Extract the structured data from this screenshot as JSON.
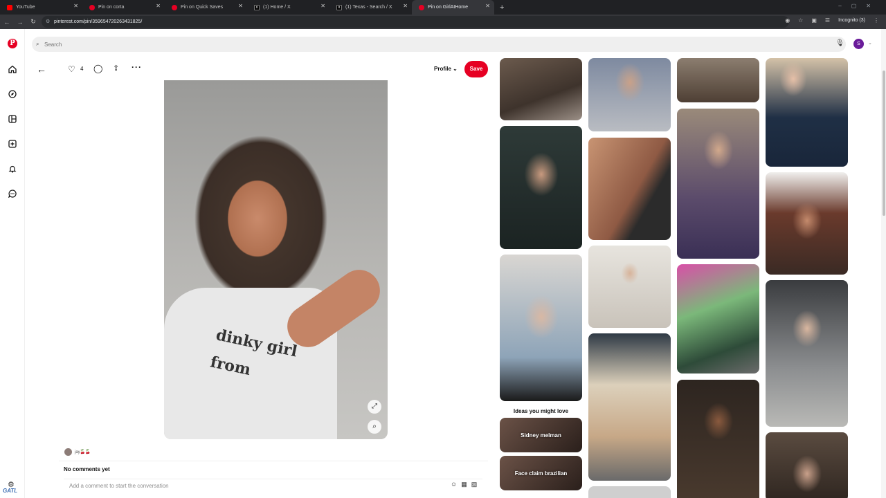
{
  "browser": {
    "tabs": [
      {
        "label": "YouTube",
        "favicon": "youtube-icon"
      },
      {
        "label": "Pin on corta",
        "favicon": "pinterest-icon"
      },
      {
        "label": "Pin on Quick Saves",
        "favicon": "pinterest-icon"
      },
      {
        "label": "(1) Home / X",
        "favicon": "x-icon"
      },
      {
        "label": "(1) Texas - Search / X",
        "favicon": "x-icon"
      },
      {
        "label": "Pin on GirlAtHome",
        "favicon": "pinterest-icon",
        "active": true
      }
    ],
    "url": "pinterest.com/pin/359654720263431825/",
    "incognito_label": "Incognito (3)"
  },
  "search": {
    "placeholder": "Search"
  },
  "avatar_initial": "S",
  "pin": {
    "like_count": "4",
    "profile_label": "Profile",
    "save_label": "Save",
    "shirt_text": "dinky girl from",
    "owner_name": "jay🍒🍒",
    "no_comments": "No comments yet",
    "comment_placeholder": "Add a comment to start the conversation"
  },
  "grid": {
    "ideas_title": "Ideas you might love",
    "ideas": [
      "Sidney melman",
      "Face claim brazilian"
    ]
  },
  "colors": {
    "brand": "#e60023",
    "avatar": "#6a1b9a"
  },
  "watermark": "GATL"
}
